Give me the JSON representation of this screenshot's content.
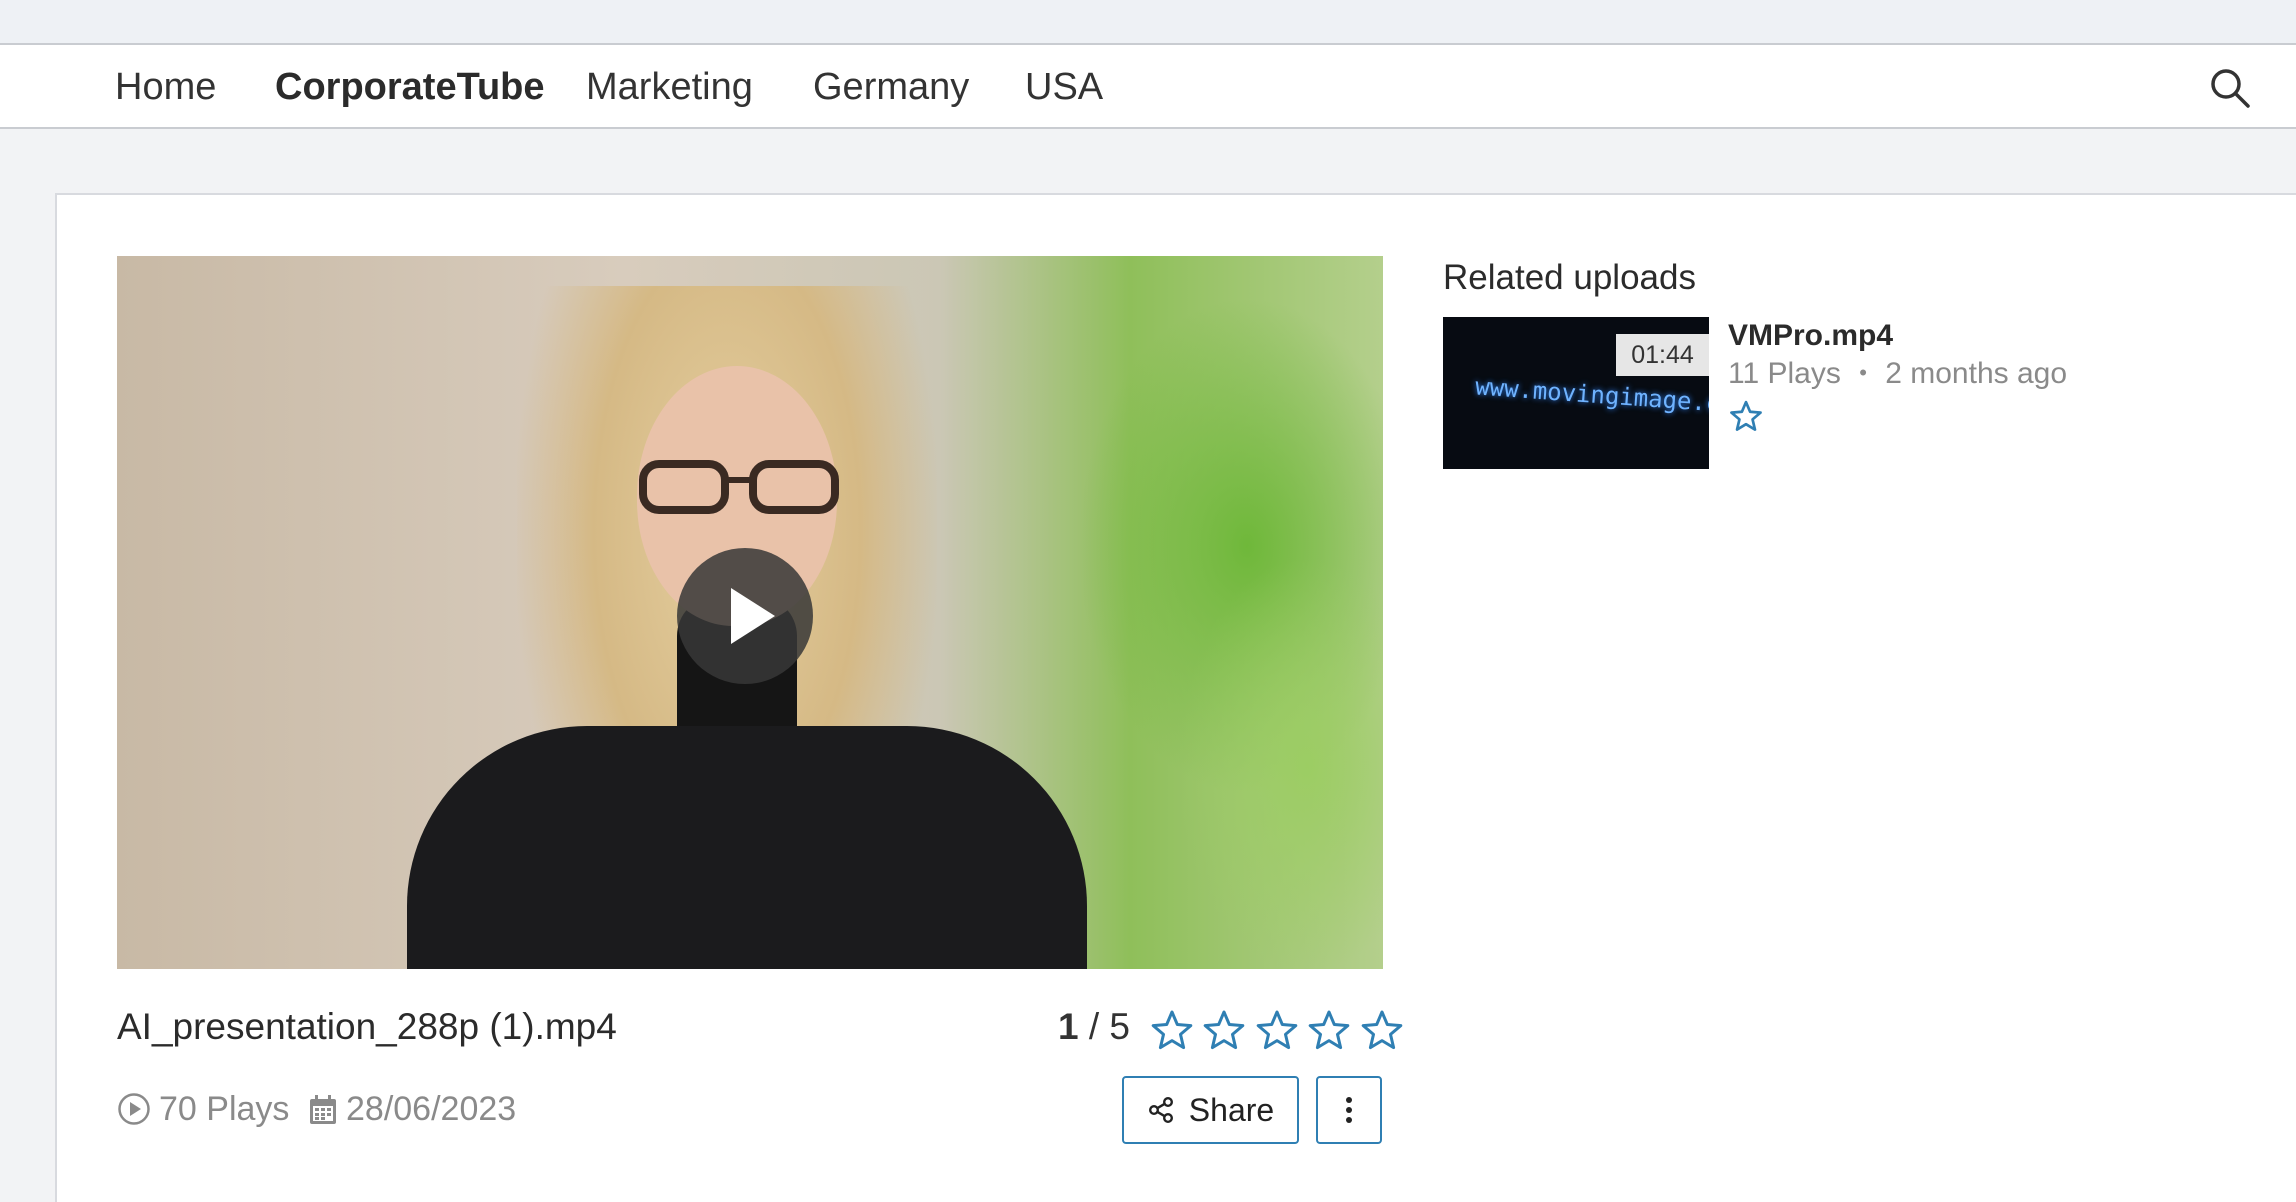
{
  "nav": {
    "items": [
      {
        "label": "Home"
      },
      {
        "label": "CorporateTube",
        "active": true
      },
      {
        "label": "Marketing"
      },
      {
        "label": "Germany"
      },
      {
        "label": "USA"
      }
    ],
    "search_icon": "search-icon"
  },
  "video": {
    "title": "AI_presentation_288p (1).mp4",
    "rating_value": "1",
    "rating_max": "/ 5",
    "stars": 5,
    "plays": "70 Plays",
    "date": "28/06/2023",
    "share_label": "Share"
  },
  "related": {
    "title": "Related uploads",
    "items": [
      {
        "name": "VMPro.mp4",
        "duration": "01:44",
        "plays": "11 Plays",
        "separator": "•",
        "age": "2 months ago",
        "thumb_text": "www.movingimage.c"
      }
    ]
  },
  "colors": {
    "accent": "#2f7fb3",
    "muted_text": "#8a8a8a",
    "background": "#f2f3f5"
  }
}
